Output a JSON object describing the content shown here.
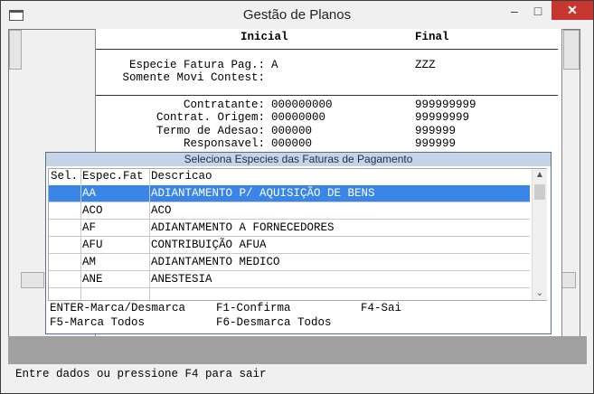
{
  "window": {
    "title": "Gestão de Planos",
    "minimize": "–",
    "maximize": "□",
    "close": "✕"
  },
  "header": {
    "col_initial": "Inicial",
    "col_final": "Final"
  },
  "fields": [
    {
      "label": "Especie Fatura Pag.:",
      "initial": "A",
      "final": "ZZZ"
    },
    {
      "label": "Somente Movi Contest:",
      "initial": "",
      "final": ""
    },
    {
      "label": "Contratante:",
      "initial": "000000000",
      "final": "999999999"
    },
    {
      "label": "Contrat. Origem:",
      "initial": "00000000",
      "final": "99999999"
    },
    {
      "label": "Termo de Adesao:",
      "initial": "000000",
      "final": "999999"
    },
    {
      "label": "Responsavel:",
      "initial": "000000",
      "final": "999999"
    }
  ],
  "dialog": {
    "title": "Seleciona Especies das Faturas de Pagamento",
    "columns": [
      "Sel.",
      "Espec.Fat",
      "Descricao"
    ],
    "rows": [
      {
        "sel": "",
        "code": "AA",
        "desc": "ADIANTAMENTO P/ AQUISIÇÃO DE BENS",
        "selected": true
      },
      {
        "sel": "",
        "code": "ACO",
        "desc": "ACO",
        "selected": false
      },
      {
        "sel": "",
        "code": "AF",
        "desc": "ADIANTAMENTO A FORNECEDORES",
        "selected": false
      },
      {
        "sel": "",
        "code": "AFU",
        "desc": "CONTRIBUIÇÃO AFUA",
        "selected": false
      },
      {
        "sel": "",
        "code": "AM",
        "desc": "ADIANTAMENTO MEDICO",
        "selected": false
      },
      {
        "sel": "",
        "code": "ANE",
        "desc": "ANESTESIA",
        "selected": false
      },
      {
        "sel": "",
        "code": "",
        "desc": "",
        "selected": false
      }
    ],
    "keys": {
      "enter": "ENTER-Marca/Desmarca",
      "f1": "F1-Confirma",
      "f4": "F4-Sai",
      "f5": "F5-Marca Todos",
      "f6": "F6-Desmarca Todos"
    }
  },
  "status_bar": {
    "message": "Entre dados ou pressione F4 para sair"
  },
  "colors": {
    "selection": "#3a86e8",
    "dialog_title_bg": "#c5d4e6",
    "close_button": "#c7372f"
  }
}
